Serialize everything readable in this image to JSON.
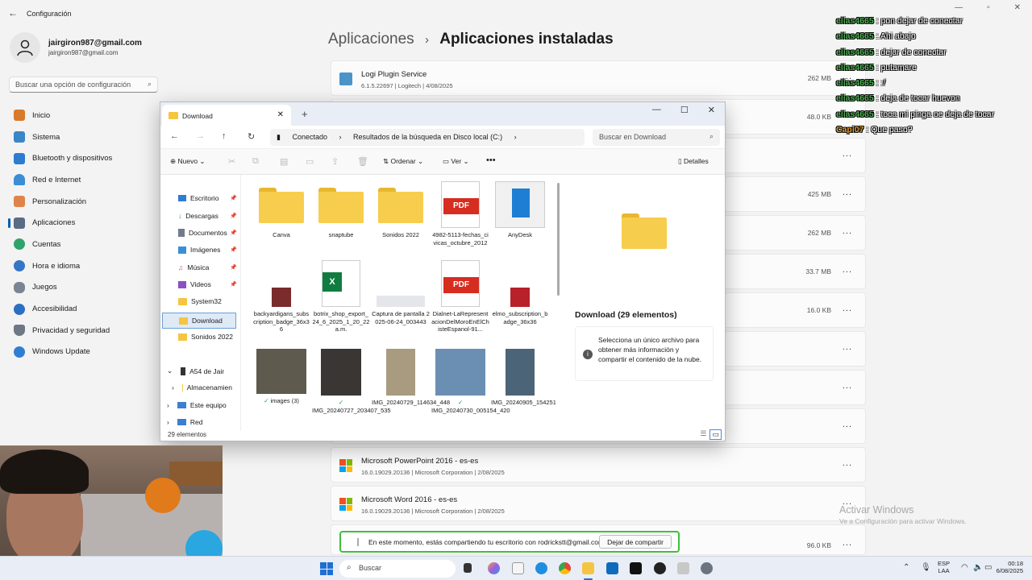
{
  "settings": {
    "title": "Configuración",
    "profile": {
      "name": "jairgiron987@gmail.com",
      "email": "jairgiron987@gmail.com"
    },
    "search_placeholder": "Buscar una opción de configuración",
    "nav": [
      {
        "label": "Inicio",
        "icon": "home-icon",
        "color": "#d97a2b"
      },
      {
        "label": "Sistema",
        "icon": "system-icon",
        "color": "#3a86c8"
      },
      {
        "label": "Bluetooth y dispositivos",
        "icon": "bluetooth-icon",
        "color": "#2c7cd0"
      },
      {
        "label": "Red e Internet",
        "icon": "wifi-icon",
        "color": "#3b8dd6"
      },
      {
        "label": "Personalización",
        "icon": "brush-icon",
        "color": "#e0834a"
      },
      {
        "label": "Aplicaciones",
        "icon": "apps-icon",
        "color": "#5a6b84"
      },
      {
        "label": "Cuentas",
        "icon": "accounts-icon",
        "color": "#2fa36b"
      },
      {
        "label": "Hora e idioma",
        "icon": "globe-icon",
        "color": "#3576c6"
      },
      {
        "label": "Juegos",
        "icon": "gamepad-icon",
        "color": "#7a8594"
      },
      {
        "label": "Accesibilidad",
        "icon": "accessibility-icon",
        "color": "#2c6fc2"
      },
      {
        "label": "Privacidad y seguridad",
        "icon": "shield-icon",
        "color": "#6d7785"
      },
      {
        "label": "Windows Update",
        "icon": "update-icon",
        "color": "#2e7fd1"
      }
    ],
    "breadcrumb": {
      "parent": "Aplicaciones",
      "sep": "›",
      "current": "Aplicaciones instaladas"
    },
    "apps": [
      {
        "name": "Logi Plugin Service",
        "meta": "6.1.5.22697  |  Logitech  |  4/08/2025",
        "size": "262 MB",
        "more": "..."
      },
      {
        "name": "",
        "meta": "",
        "size": "48.0 KB",
        "more": "..."
      },
      {
        "name": "",
        "meta": "",
        "size": "",
        "more": "..."
      },
      {
        "name": "",
        "meta": "",
        "size": "425 MB",
        "more": "..."
      },
      {
        "name": "",
        "meta": "",
        "size": "262 MB",
        "more": "..."
      },
      {
        "name": "",
        "meta": "",
        "size": "33.7 MB",
        "more": "..."
      },
      {
        "name": "",
        "meta": "",
        "size": "16.0 KB",
        "more": "..."
      },
      {
        "name": "",
        "meta": "",
        "size": "",
        "more": "..."
      },
      {
        "name": "",
        "meta": "",
        "size": "",
        "more": "..."
      },
      {
        "name": "",
        "meta": "",
        "size": "",
        "more": "..."
      },
      {
        "name": "Microsoft PowerPoint 2016 - es-es",
        "meta": "16.0.19029.20136  |  Microsoft Corporation  |  2/08/2025",
        "size": "",
        "more": "..."
      },
      {
        "name": "Microsoft Word 2016 - es-es",
        "meta": "16.0.19029.20136  |  Microsoft Corporation  |  2/08/2025",
        "size": "",
        "more": "..."
      },
      {
        "name": "",
        "meta": "",
        "size": "96.0 KB",
        "more": "..."
      }
    ]
  },
  "chat": [
    {
      "user": "elias4665",
      "msg": ": pon dejar de conectar"
    },
    {
      "user": "elias4665",
      "msg": ": Ahi abajo"
    },
    {
      "user": "elias4665",
      "msg": ": dejar de conectar"
    },
    {
      "user": "elias4665",
      "msg": ": putamare"
    },
    {
      "user": "elias4665",
      "msg": ": :/"
    },
    {
      "user": "elias4665",
      "msg": ": deja de tocar huevon"
    },
    {
      "user": "elias4665",
      "msg": ": toca mi pinga oe deja de tocar"
    },
    {
      "user": "Capi07",
      "msg": ": Que paso?"
    }
  ],
  "explorer": {
    "tab": "Download",
    "address": {
      "root": "Conectado",
      "path": "Resultados de la búsqueda en Disco local (C:)"
    },
    "search_placeholder": "Buscar en Download",
    "commands": {
      "new": "Nuevo",
      "sort": "Ordenar",
      "view": "Ver",
      "more": "•••",
      "details": "Detalles"
    },
    "nav": [
      {
        "label": "Escritorio"
      },
      {
        "label": "Descargas"
      },
      {
        "label": "Documentos"
      },
      {
        "label": "Imágenes"
      },
      {
        "label": "Música"
      },
      {
        "label": "Videos"
      },
      {
        "label": "System32"
      },
      {
        "label": "Download"
      },
      {
        "label": "Sonidos 2022"
      },
      {
        "label": "A54 de Jair"
      },
      {
        "label": "Almacenamien"
      },
      {
        "label": "Este equipo"
      },
      {
        "label": "Red"
      }
    ],
    "files": [
      {
        "label": "Canva",
        "kind": "folder"
      },
      {
        "label": "snaptube",
        "kind": "folder"
      },
      {
        "label": "Sonidos 2022",
        "kind": "folder"
      },
      {
        "label": "4982-5113-fechas_civicas_octubre_2012",
        "kind": "pdf"
      },
      {
        "label": "AnyDesk",
        "kind": "app"
      },
      {
        "label": "backyardigans_subscription_badge_36x36",
        "kind": "img"
      },
      {
        "label": "botrix_shop_export_24_6_2025_1_20_22 a.m.",
        "kind": "excel"
      },
      {
        "label": "Captura de pantalla 2025-06-24_003443",
        "kind": "img"
      },
      {
        "label": "Dialnet-LaRepresentacionDelMoroEnElChisteEspanol-91...",
        "kind": "pdf"
      },
      {
        "label": "elmo_subscription_badge_36x36",
        "kind": "img"
      },
      {
        "label": "images (3)",
        "kind": "photo"
      },
      {
        "label": "IMG_20240727_203407_535",
        "kind": "photo"
      },
      {
        "label": "IMG_20240729_114634_448",
        "kind": "photo"
      },
      {
        "label": "IMG_20240730_005154_420",
        "kind": "photo"
      },
      {
        "label": "IMG_20240905_154251_811",
        "kind": "photo"
      }
    ],
    "preview": {
      "title": "Download (29 elementos)",
      "info": "Selecciona un único archivo para obtener más información y compartir el contenido de la nube."
    },
    "status": "29 elementos"
  },
  "sharebar": {
    "message": "En este momento, estás compartiendo tu escritorio con rodrickstt@gmail.com",
    "button": "Dejar de compartir"
  },
  "activation": {
    "title": "Activar Windows",
    "subtitle": "Ve a Configuración para activar Windows."
  },
  "taskbar": {
    "search_placeholder": "Buscar",
    "lang": "ESP",
    "region": "LAA",
    "time": "00:18",
    "date": "6/08/2025"
  }
}
